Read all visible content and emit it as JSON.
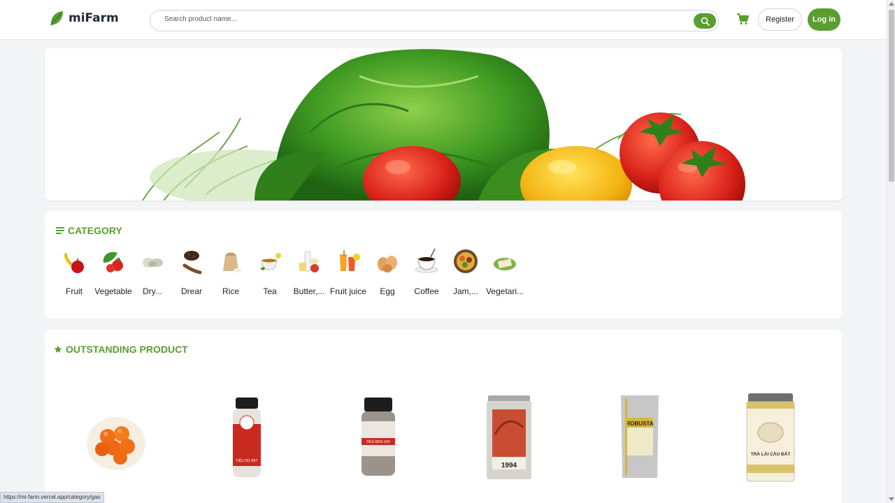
{
  "header": {
    "brand": "miFarm",
    "search_placeholder": "Search product name...",
    "register_label": "Register",
    "login_label": "Log in",
    "brand_color": "#5a9e2f"
  },
  "category": {
    "title": "CATEGORY",
    "items": [
      {
        "label": "Fruit",
        "icon": "banana-apple-icon"
      },
      {
        "label": "Vegetable",
        "icon": "vegetable-icon"
      },
      {
        "label": "Dry...",
        "icon": "dry-food-icon"
      },
      {
        "label": "Drear",
        "icon": "pepper-icon"
      },
      {
        "label": "Rice",
        "icon": "rice-sack-icon"
      },
      {
        "label": "Tea",
        "icon": "tea-cup-icon"
      },
      {
        "label": "Butter,...",
        "icon": "dairy-icon"
      },
      {
        "label": "Fruit juice",
        "icon": "juice-icon"
      },
      {
        "label": "Egg",
        "icon": "egg-icon"
      },
      {
        "label": "Coffee",
        "icon": "coffee-icon"
      },
      {
        "label": "Jam,...",
        "icon": "jam-icon"
      },
      {
        "label": "Vegetari...",
        "icon": "vegetarian-icon"
      }
    ]
  },
  "outstanding": {
    "title": "OUTSTANDING PRODUCT",
    "products": [
      {
        "name": "salted-egg-yolk"
      },
      {
        "name": "pepper-shaker-red",
        "label_text": "TIÊU SỌ HẠT"
      },
      {
        "name": "pepper-shaker-black",
        "label_text": "TIÊU ĐEN XAY"
      },
      {
        "name": "coffee-tin",
        "label_text": "1994"
      },
      {
        "name": "robusta-bag",
        "label_text": "ROBUSTA"
      },
      {
        "name": "tea-tin",
        "label_text": "TRÀ LÀI CẦU ĐẤT"
      }
    ]
  },
  "status_bar": {
    "url": "https://mi-farm.vercel.app/category/gao"
  }
}
